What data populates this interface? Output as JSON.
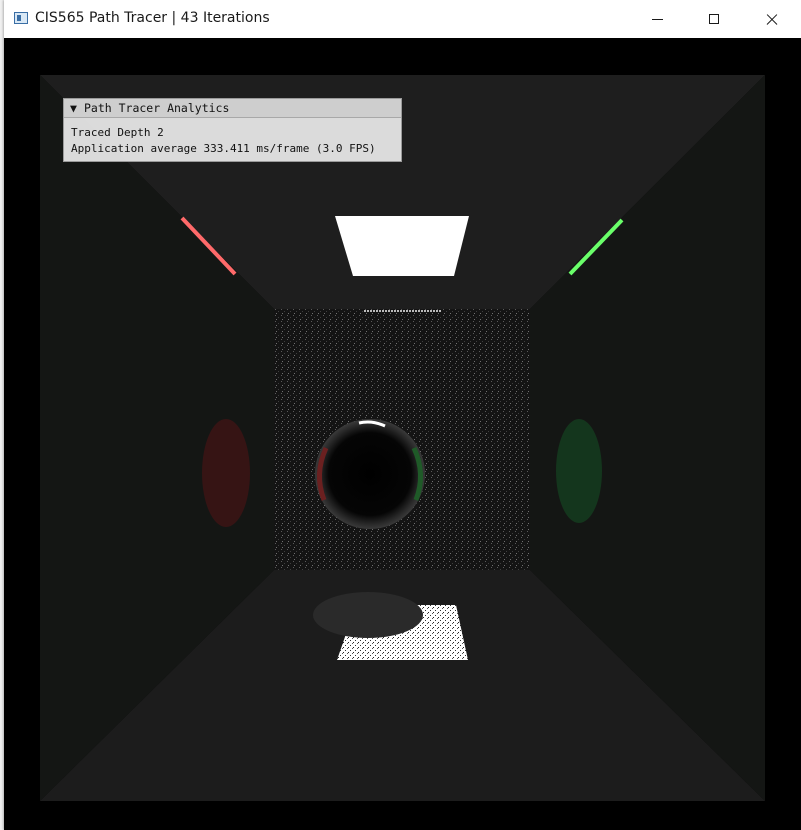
{
  "window": {
    "title": "CIS565 Path Tracer | 43 Iterations",
    "controls": {
      "minimize": "minimize-icon",
      "maximize": "maximize-icon",
      "close": "close-icon"
    }
  },
  "analytics": {
    "arrow": "▼",
    "header": "Path Tracer Analytics",
    "traced_depth": "Traced Depth 2",
    "application_average": "Application average 333.411 ms/frame (3.0 FPS)"
  },
  "colors": {
    "left_wall": "#ff6a6a",
    "right_wall": "#6aff6a",
    "light": "#ffffff",
    "background": "#000000"
  }
}
